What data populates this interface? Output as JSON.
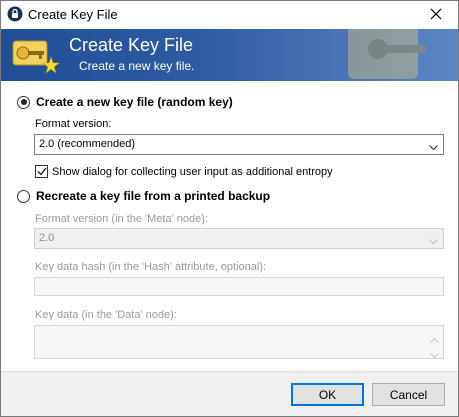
{
  "window": {
    "title": "Create Key File"
  },
  "banner": {
    "title": "Create Key File",
    "subtitle": "Create a new key file."
  },
  "option_new": {
    "label": "Create a new key file (random key)",
    "selected": true,
    "format_label": "Format version:",
    "format_value": "2.0 (recommended)",
    "entropy_label": "Show dialog for collecting user input as additional entropy",
    "entropy_checked": true
  },
  "option_recreate": {
    "label": "Recreate a key file from a printed backup",
    "selected": false,
    "format_label": "Format version (in the 'Meta' node):",
    "format_value": "2.0",
    "hash_label": "Key data hash (in the 'Hash' attribute, optional):",
    "hash_value": "",
    "data_label": "Key data (in the 'Data' node):",
    "data_value": ""
  },
  "buttons": {
    "ok": "OK",
    "cancel": "Cancel"
  },
  "icons": [
    "lock-icon",
    "close-icon",
    "key-icon",
    "chevron-down-icon",
    "check-icon",
    "scroll-up-icon",
    "scroll-down-icon"
  ]
}
